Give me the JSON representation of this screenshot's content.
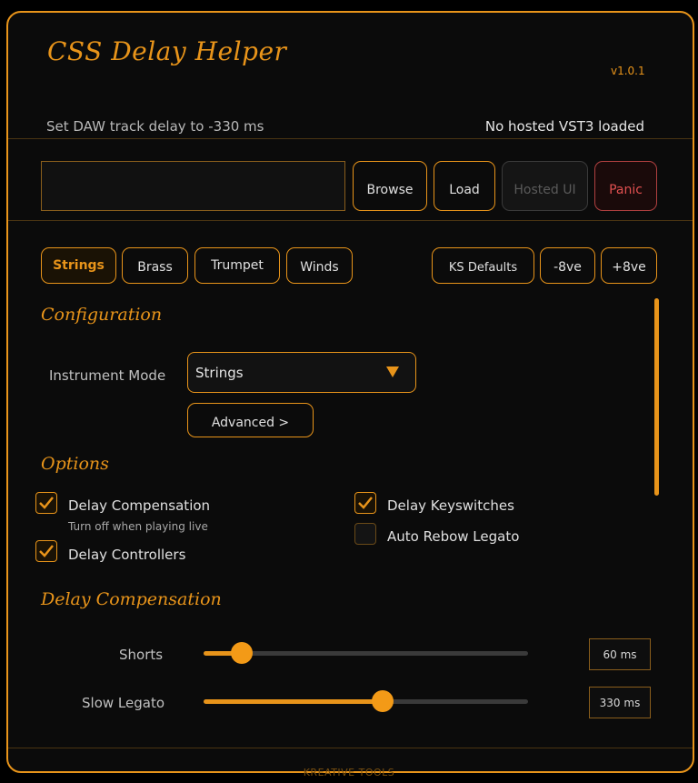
{
  "app": {
    "title": "CSS Delay Helper",
    "version": "v1.0.1"
  },
  "status": {
    "delay_text": "Set DAW track delay to -330 ms",
    "host_text": "No hosted VST3 loaded"
  },
  "host_buttons": {
    "browse": "Browse",
    "load": "Load",
    "hosted_ui": "Hosted UI",
    "panic": "Panic"
  },
  "tabs": {
    "strings": "Strings",
    "brass": "Brass",
    "trumpet": "Trumpet",
    "winds": "Winds"
  },
  "tools": {
    "ks_defaults": "KS Defaults",
    "octave_down": "-8ve",
    "octave_up": "+8ve"
  },
  "configuration": {
    "title": "Configuration",
    "instrument_mode_label": "Instrument Mode",
    "instrument_mode_value": "Strings",
    "advanced": "Advanced >"
  },
  "options": {
    "title": "Options",
    "delay_compensation": {
      "label": "Delay Compensation",
      "sub": "Turn off when playing live",
      "checked": true
    },
    "delay_controllers": {
      "label": "Delay Controllers",
      "checked": true
    },
    "delay_keyswitches": {
      "label": "Delay Keyswitches",
      "checked": true
    },
    "auto_rebow": {
      "label": "Auto Rebow Legato",
      "checked": false
    }
  },
  "delay_compensation": {
    "title": "Delay Compensation",
    "shorts": {
      "label": "Shorts",
      "value_text": "60 ms",
      "fraction": 0.117
    },
    "slow_legato": {
      "label": "Slow Legato",
      "value_text": "330 ms",
      "fraction": 0.551
    }
  },
  "footer": "KREATIVE TOOLS",
  "colors": {
    "accent": "#e8941a",
    "panic": "#e05050",
    "background": "#0b0b0b"
  }
}
